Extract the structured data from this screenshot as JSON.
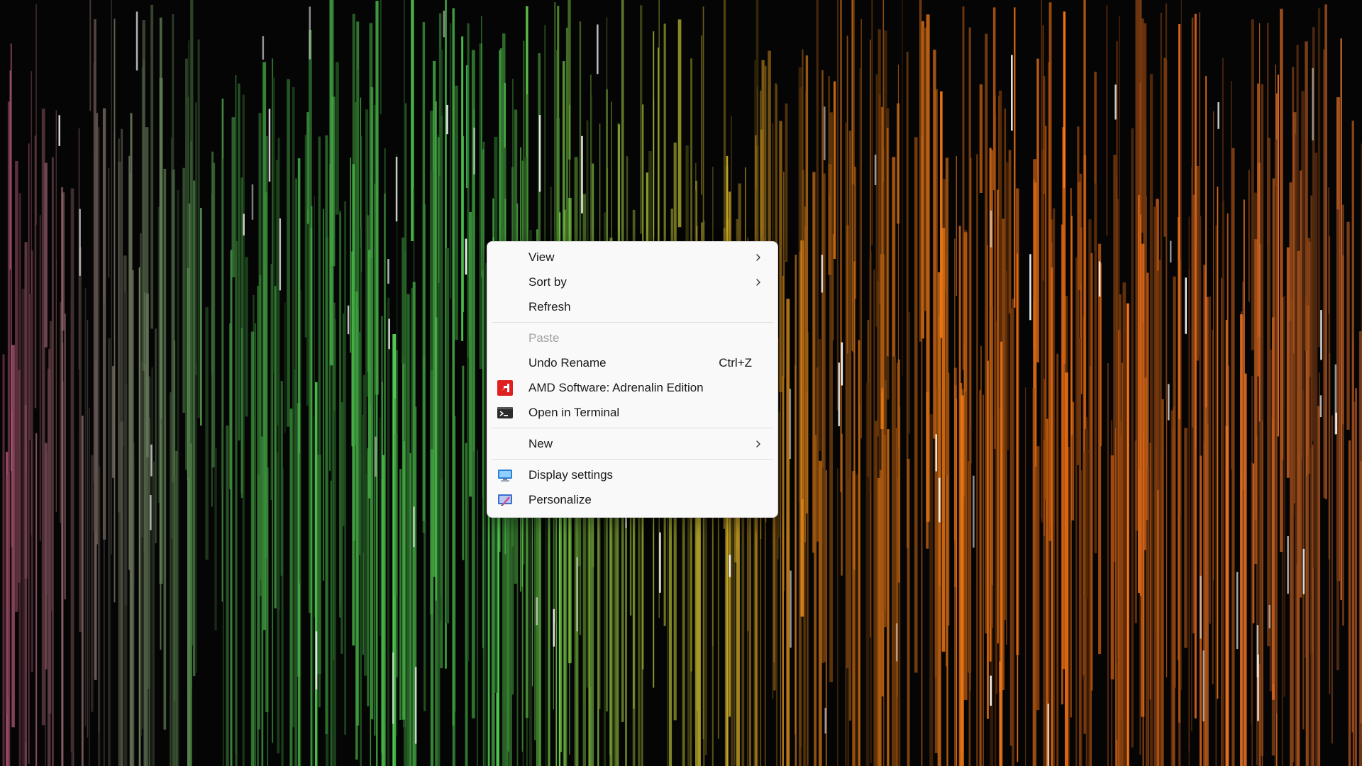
{
  "desktop": {
    "context_menu": {
      "groups": [
        {
          "items": [
            {
              "label": "View",
              "shortcut": "",
              "submenu": true,
              "icon": "",
              "disabled": false
            },
            {
              "label": "Sort by",
              "shortcut": "",
              "submenu": true,
              "icon": "",
              "disabled": false
            },
            {
              "label": "Refresh",
              "shortcut": "",
              "submenu": false,
              "icon": "",
              "disabled": false
            }
          ]
        },
        {
          "items": [
            {
              "label": "Paste",
              "shortcut": "",
              "submenu": false,
              "icon": "",
              "disabled": true
            },
            {
              "label": "Undo Rename",
              "shortcut": "Ctrl+Z",
              "submenu": false,
              "icon": "",
              "disabled": false
            },
            {
              "label": "AMD Software: Adrenalin Edition",
              "shortcut": "",
              "submenu": false,
              "icon": "amd-icon",
              "disabled": false
            },
            {
              "label": "Open in Terminal",
              "shortcut": "",
              "submenu": false,
              "icon": "terminal-icon",
              "disabled": false
            }
          ]
        },
        {
          "items": [
            {
              "label": "New",
              "shortcut": "",
              "submenu": true,
              "icon": "",
              "disabled": false
            }
          ]
        },
        {
          "items": [
            {
              "label": "Display settings",
              "shortcut": "",
              "submenu": false,
              "icon": "display-settings-icon",
              "disabled": false
            },
            {
              "label": "Personalize",
              "shortcut": "",
              "submenu": false,
              "icon": "personalize-icon",
              "disabled": false
            }
          ]
        }
      ]
    }
  },
  "colors": {
    "amd_red": "#e02020",
    "terminal_dark": "#2b2b2b",
    "display_blue": "#2f7fd8"
  }
}
